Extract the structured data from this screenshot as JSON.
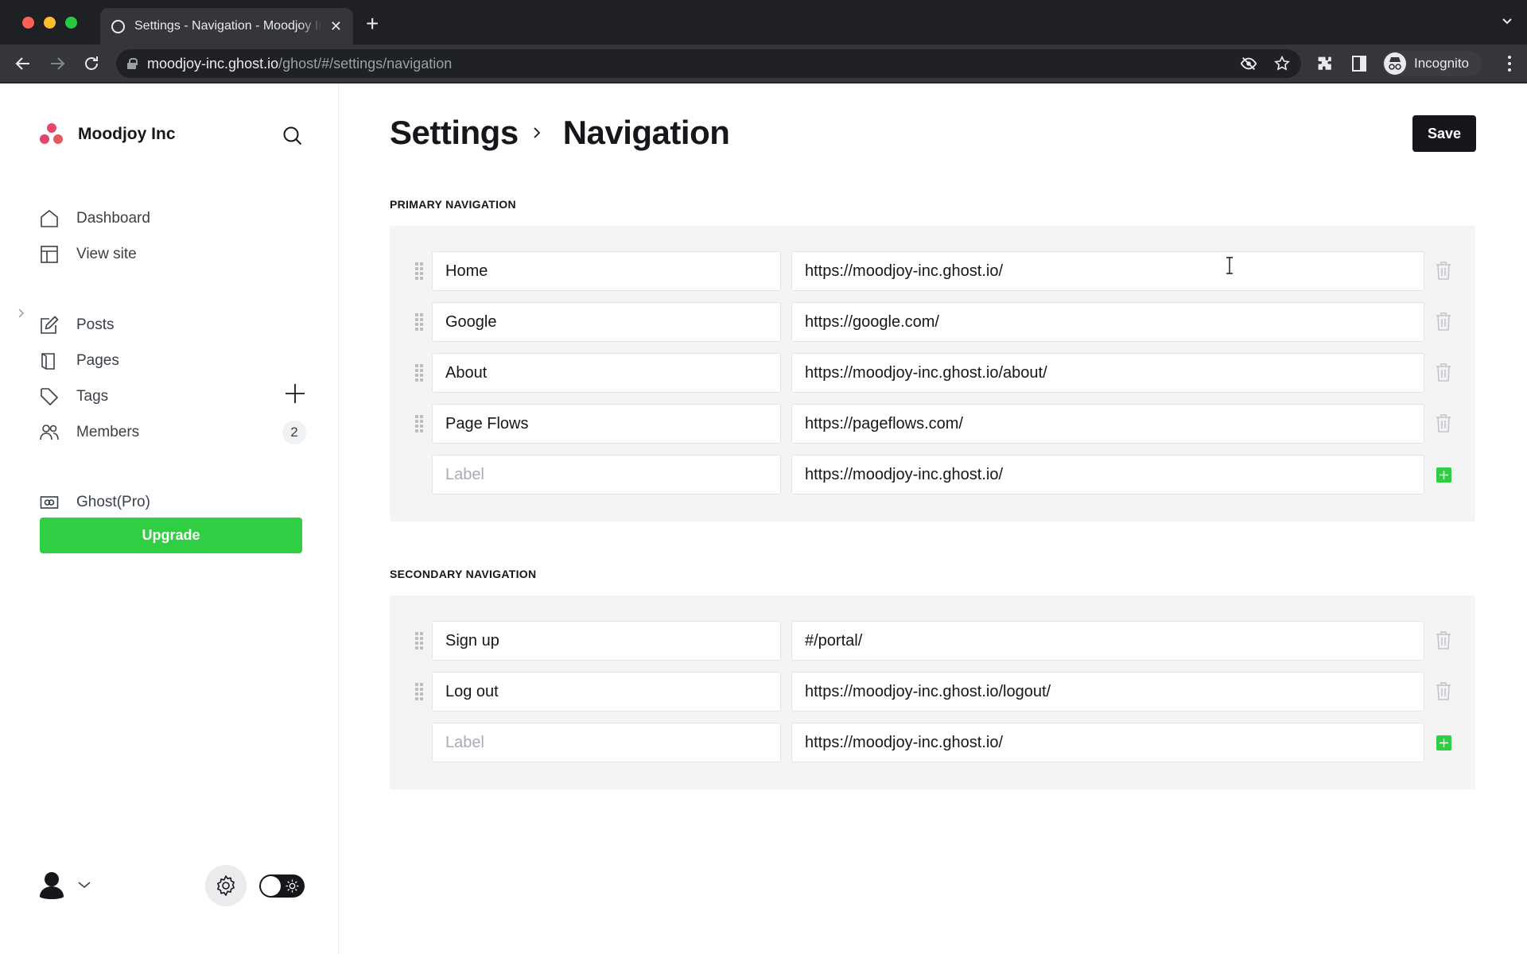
{
  "browser": {
    "tab_title": "Settings - Navigation - Moodjoy Inc",
    "url_host": "moodjoy-inc.ghost.io",
    "url_path": "/ghost/#/settings/navigation",
    "profile_label": "Incognito"
  },
  "sidebar": {
    "site_name": "Moodjoy Inc",
    "items": [
      {
        "label": "Dashboard",
        "icon": "home-icon"
      },
      {
        "label": "View site",
        "icon": "layout-icon"
      },
      {
        "label": "Posts",
        "icon": "edit-icon"
      },
      {
        "label": "Pages",
        "icon": "pages-icon"
      },
      {
        "label": "Tags",
        "icon": "tag-icon"
      },
      {
        "label": "Members",
        "icon": "members-icon",
        "badge": "2"
      },
      {
        "label": "Ghost(Pro)",
        "icon": "ghost-pro-icon"
      }
    ],
    "upgrade_label": "Upgrade",
    "brand_color": "#e8476a",
    "upgrade_color": "#30cf43"
  },
  "header": {
    "breadcrumb_parent": "Settings",
    "breadcrumb_current": "Navigation",
    "save_label": "Save"
  },
  "primary": {
    "title": "Primary navigation",
    "items": [
      {
        "label": "Home",
        "url": "https://moodjoy-inc.ghost.io/"
      },
      {
        "label": "Google",
        "url": "https://google.com/"
      },
      {
        "label": "About",
        "url": "https://moodjoy-inc.ghost.io/about/"
      },
      {
        "label": "Page Flows",
        "url": "https://pageflows.com/"
      }
    ],
    "new_item": {
      "label_placeholder": "Label",
      "url": "https://moodjoy-inc.ghost.io/"
    }
  },
  "secondary": {
    "title": "Secondary navigation",
    "items": [
      {
        "label": "Sign up",
        "url": "#/portal/"
      },
      {
        "label": "Log out",
        "url": "https://moodjoy-inc.ghost.io/logout/"
      }
    ],
    "new_item": {
      "label_placeholder": "Label",
      "url": "https://moodjoy-inc.ghost.io/"
    }
  }
}
